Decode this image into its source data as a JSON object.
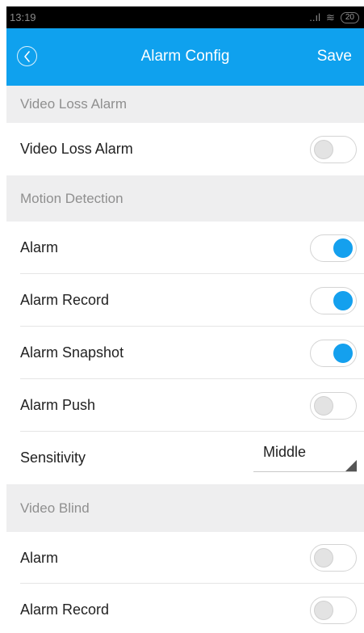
{
  "status_bar": {
    "time": "13:19",
    "signal": "..ıl",
    "wifi": "≋",
    "battery": "20"
  },
  "header": {
    "back_icon": "chevron-left-circle-icon",
    "title": "Alarm Config",
    "save_label": "Save"
  },
  "sections": [
    {
      "title": "Video Loss Alarm",
      "rows": [
        {
          "label": "Video Loss Alarm",
          "toggle": false
        }
      ]
    },
    {
      "title": "Motion Detection",
      "rows": [
        {
          "label": "Alarm",
          "toggle": true
        },
        {
          "label": "Alarm Record",
          "toggle": true
        },
        {
          "label": "Alarm Snapshot",
          "toggle": true
        },
        {
          "label": "Alarm Push",
          "toggle": false
        },
        {
          "label": "Sensitivity",
          "select_value": "Middle"
        }
      ]
    },
    {
      "title": "Video Blind",
      "rows": [
        {
          "label": "Alarm",
          "toggle": false
        },
        {
          "label": "Alarm Record",
          "toggle": false
        }
      ]
    }
  ],
  "colors": {
    "accent": "#0fa1ee",
    "toggle_on": "#14a0ee",
    "section_bg": "#eeeeef"
  }
}
